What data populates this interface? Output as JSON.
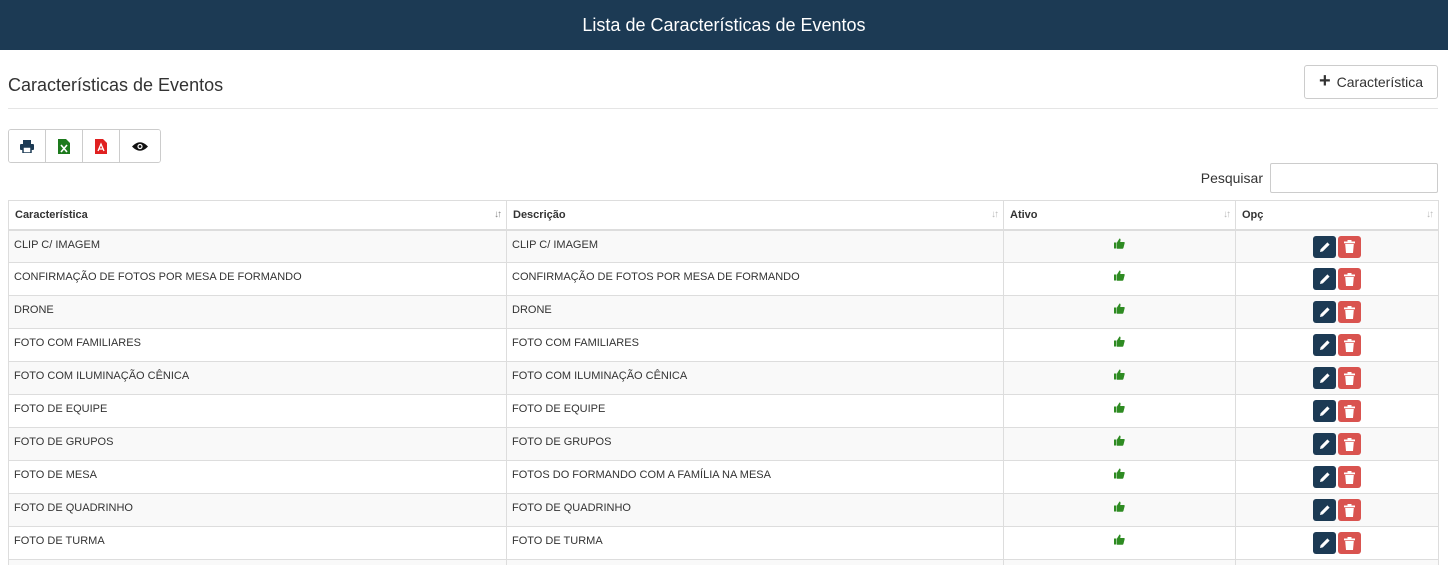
{
  "header": {
    "title": "Lista de Características de Eventos"
  },
  "page": {
    "title": "Características de Eventos",
    "add_button_label": "Característica"
  },
  "toolbar": {
    "buttons": [
      "print-icon",
      "excel-icon",
      "pdf-icon",
      "eye-icon"
    ]
  },
  "search": {
    "label": "Pesquisar",
    "value": ""
  },
  "table": {
    "columns": [
      "Característica",
      "Descrição",
      "Ativo",
      "Opç"
    ],
    "rows": [
      {
        "caracteristica": "CLIP C/ IMAGEM",
        "descricao": "CLIP C/ IMAGEM",
        "ativo": true
      },
      {
        "caracteristica": "CONFIRMAÇÃO DE FOTOS POR MESA DE FORMANDO",
        "descricao": "CONFIRMAÇÃO DE FOTOS POR MESA DE FORMANDO",
        "ativo": true
      },
      {
        "caracteristica": "DRONE",
        "descricao": "DRONE",
        "ativo": true
      },
      {
        "caracteristica": "FOTO COM FAMILIARES",
        "descricao": "FOTO COM FAMILIARES",
        "ativo": true
      },
      {
        "caracteristica": "FOTO COM ILUMINAÇÃO CÊNICA",
        "descricao": "FOTO COM ILUMINAÇÃO CÊNICA",
        "ativo": true
      },
      {
        "caracteristica": "FOTO DE EQUIPE",
        "descricao": "FOTO DE EQUIPE",
        "ativo": true
      },
      {
        "caracteristica": "FOTO DE GRUPOS",
        "descricao": "FOTO DE GRUPOS",
        "ativo": true
      },
      {
        "caracteristica": "FOTO DE MESA",
        "descricao": "FOTOS DO FORMANDO COM A FAMÍLIA NA MESA",
        "ativo": true
      },
      {
        "caracteristica": "FOTO DE QUADRINHO",
        "descricao": "FOTO DE QUADRINHO",
        "ativo": true
      },
      {
        "caracteristica": "FOTO DE TURMA",
        "descricao": "FOTO DE TURMA",
        "ativo": true
      },
      {
        "caracteristica": "",
        "descricao": "",
        "ativo": false
      }
    ]
  },
  "colors": {
    "topbar": "#1c3a54",
    "edit_button": "#1c3a54",
    "delete_button": "#d9534f",
    "active_icon": "#2e8b22",
    "excel_icon": "#1d7a1d",
    "pdf_icon": "#e02020"
  }
}
